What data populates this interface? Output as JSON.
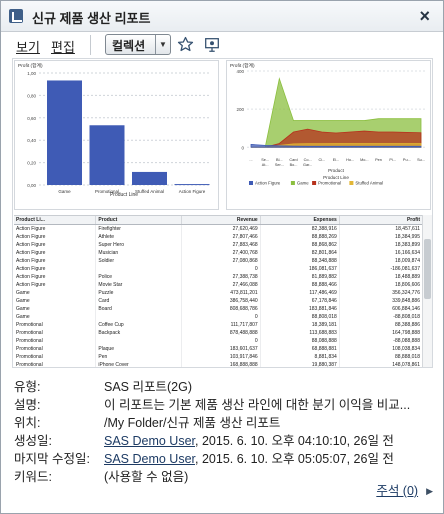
{
  "window": {
    "title": "신규 제품 생산 리포트",
    "close_icon": "close-icon"
  },
  "toolbar": {
    "menus": [
      "보기",
      "편집"
    ],
    "collection_label": "컬렉션",
    "favorite_icon": "star-icon",
    "view_icon": "monitor-icon"
  },
  "charts": {
    "bar_header": "Profit (합계)",
    "line_header": "Profit (합계)",
    "bar_xlabel": "Product Line",
    "line_xlabel": "Product",
    "legend_title": "Product Line"
  },
  "chart_data": [
    {
      "type": "bar",
      "categories": [
        "Game",
        "Promotional",
        "Stuffed Animal",
        "Action Figure"
      ],
      "values": [
        1120000,
        640000,
        140000,
        10000
      ],
      "ylabel": "Profit (합계)",
      "xlabel": "Product Line",
      "ylim": [
        0,
        1200000
      ],
      "yticks": [
        "1,00",
        "0,80",
        "0,60",
        "0,40",
        "0,20",
        "0,00"
      ],
      "grid": true,
      "color": "#3f5bb5"
    },
    {
      "type": "area",
      "ylabel": "Profit (합계)",
      "xlabel": "Product",
      "categories": [
        "...",
        "Se...",
        "Bl...",
        "Card",
        "Co...",
        "Ci...",
        "El...",
        "Ho...",
        "Mo...",
        "Pen",
        "Pi...",
        "Pu...",
        "Su..."
      ],
      "category_lines": [
        "At...",
        "Ser...",
        "Bo...",
        "Gar..."
      ],
      "yticks": [
        "400",
        "200",
        "0"
      ],
      "series": [
        {
          "name": "Action Figure",
          "values": [
            15000,
            10000,
            8000,
            6000,
            5000,
            5000,
            5000,
            5000,
            5000,
            5000,
            5000,
            5000,
            5000
          ],
          "color": "#3f5bb5"
        },
        {
          "name": "Game",
          "values": [
            0,
            0,
            360000,
            140000,
            140000,
            140000,
            140000,
            140000,
            140000,
            150000,
            150000,
            150000,
            150000
          ],
          "color": "#8bbf3f"
        },
        {
          "name": "Promotional",
          "values": [
            0,
            0,
            20000,
            80000,
            95000,
            80000,
            75000,
            80000,
            85000,
            80000,
            80000,
            78000,
            76000
          ],
          "color": "#b6311c"
        },
        {
          "name": "Stuffed Animal",
          "values": [
            0,
            0,
            10000,
            18000,
            19000,
            19000,
            20000,
            20000,
            20000,
            20000,
            20000,
            20000,
            20000
          ],
          "color": "#e2b636"
        }
      ],
      "legend": "bottom"
    }
  ],
  "table": {
    "columns": [
      "Product Li...",
      "Product",
      "Revenue",
      "Expenses",
      "Profit"
    ],
    "rows": [
      [
        "Action Figure",
        "Firefighter",
        "27,620,469",
        "82,388,916",
        "18,457,611"
      ],
      [
        "Action Figure",
        "Athlete",
        "27,807,466",
        "88,888,269",
        "18,384,995"
      ],
      [
        "Action Figure",
        "Super Hero",
        "27,883,468",
        "88,868,862",
        "18,383,899"
      ],
      [
        "Action Figure",
        "Musician",
        "27,400,768",
        "82,801,864",
        "16,166,634"
      ],
      [
        "Action Figure",
        "Soldier",
        "27,080,868",
        "88,348,888",
        "18,009,874"
      ],
      [
        "Action Figure",
        "",
        "0",
        "186,081,637",
        "-186,081,637"
      ],
      [
        "Action Figure",
        "Police",
        "27,388,738",
        "81,889,882",
        "18,488,889"
      ],
      [
        "Action Figure",
        "Movie Star",
        "27,466,088",
        "88,888,466",
        "18,806,606"
      ],
      [
        "Game",
        "Puzzle",
        "473,811,201",
        "117,486,469",
        "356,324,776"
      ],
      [
        "Game",
        "Card",
        "386,758,440",
        "67,178,846",
        "339,848,886"
      ],
      [
        "Game",
        "Board",
        "808,688,786",
        "183,881,846",
        "606,884,146"
      ],
      [
        "Game",
        "",
        "0",
        "88,808,018",
        "-88,808,018"
      ],
      [
        "Promotional",
        "Coffee Cup",
        "111,717,807",
        "18,389,181",
        "88,388,886"
      ],
      [
        "Promotional",
        "Backpack",
        "878,488,888",
        "113,688,883",
        "164,798,888"
      ],
      [
        "Promotional",
        "",
        "0",
        "88,088,888",
        "-88,088,888"
      ],
      [
        "Promotional",
        "Plaque",
        "183,601,637",
        "68,888,881",
        "108,038,834"
      ],
      [
        "Promotional",
        "Pen",
        "103,917,846",
        "8,881,834",
        "88,888,018"
      ],
      [
        "Promotional",
        "iPhone Cover",
        "168,888,888",
        "19,880,387",
        "148,078,861"
      ]
    ]
  },
  "meta": [
    {
      "label": "유형:",
      "value": "SAS 리포트(2G)"
    },
    {
      "label": "설명:",
      "value": "이 리포트는 기본 제품 생산 라인에 대한 분기 이익을 비교..."
    },
    {
      "label": "위치:",
      "value": "/My Folder/신규 제품 생산 리포트"
    },
    {
      "label": "생성일:",
      "link": "SAS Demo User",
      "value": ", 2015. 6. 10. 오후 04:10:10, 26일 전"
    },
    {
      "label": "마지막 수정일:",
      "link": "SAS Demo User",
      "value": ", 2015. 6. 10. 오후 05:05:07, 26일 전"
    },
    {
      "label": "키워드:",
      "value": "(사용할 수 없음)"
    }
  ],
  "comments_label": "주석 (0)"
}
